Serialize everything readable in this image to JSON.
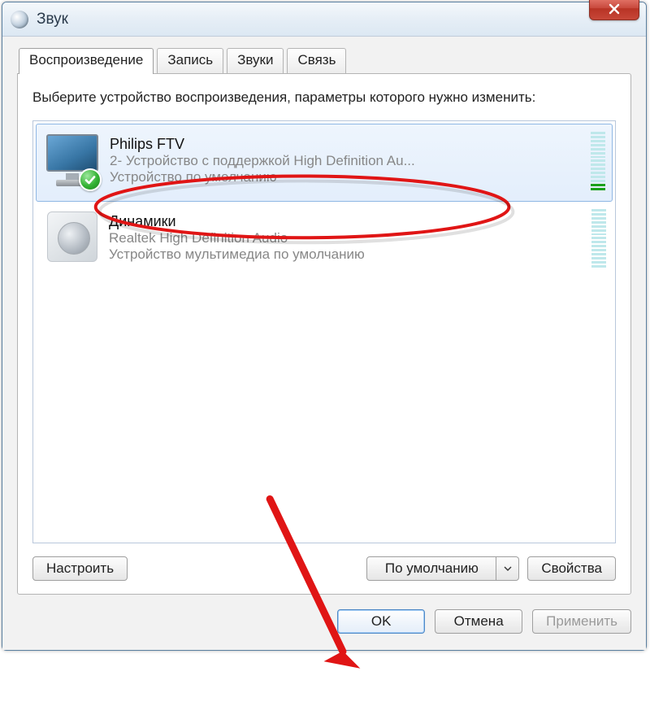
{
  "window": {
    "title": "Звук"
  },
  "tabs": [
    {
      "label": "Воспроизведение"
    },
    {
      "label": "Запись"
    },
    {
      "label": "Звуки"
    },
    {
      "label": "Связь"
    }
  ],
  "instruction": "Выберите устройство воспроизведения, параметры которого нужно изменить:",
  "devices": [
    {
      "name": "Philips FTV",
      "subtitle": "2- Устройство с поддержкой High Definition Au...",
      "status": "Устройство по умолчанию",
      "selected": true,
      "default": true,
      "icon": "monitor"
    },
    {
      "name": "Динамики",
      "subtitle": "Realtek High Definition Audio",
      "status": "Устройство мультимедиа по умолчанию",
      "selected": false,
      "default": false,
      "icon": "speaker"
    }
  ],
  "panel_buttons": {
    "configure": "Настроить",
    "set_default": "По умолчанию",
    "properties": "Свойства"
  },
  "footer_buttons": {
    "ok": "OK",
    "cancel": "Отмена",
    "apply": "Применить"
  }
}
